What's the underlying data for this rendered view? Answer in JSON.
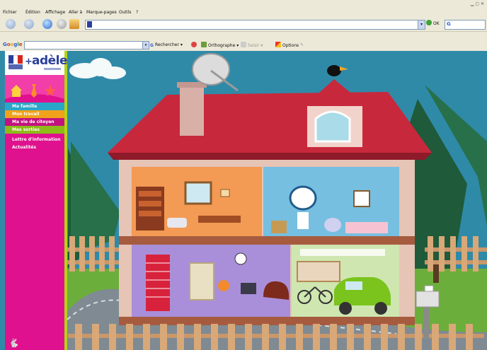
{
  "browser": {
    "menu": [
      "Fichier",
      "Édition",
      "Affichage",
      "Aller à",
      "Marque-pages",
      "Outils",
      "?"
    ],
    "go_label": "OK",
    "url_value": ""
  },
  "google_toolbar": {
    "logo": "Google",
    "search_value": "",
    "search_label": "Rechercher",
    "spell_label": "Orthographe",
    "autofill_label": "Saisir",
    "options_label": "Options"
  },
  "site": {
    "logo_text": "adèle",
    "plus": "+",
    "nav": [
      {
        "label": "Ma famille"
      },
      {
        "label": "Mon travail"
      },
      {
        "label": "Ma vie de citoyen"
      },
      {
        "label": "Mes sorties"
      },
      {
        "label": "Lettre d'information"
      },
      {
        "label": "Actualités"
      }
    ],
    "colors": {
      "sidebar": "#e0118e",
      "famille": "#2aa7c8",
      "travail": "#f0a21a",
      "citoyen": "#c11380",
      "sorties": "#8dbb19",
      "sky": "#2f8aa8",
      "roof": "#c8283c"
    }
  }
}
